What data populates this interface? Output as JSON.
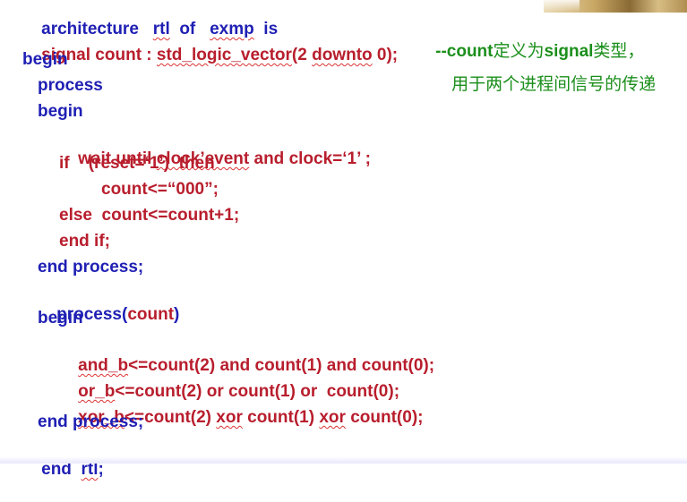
{
  "code": {
    "l1": {
      "a": "architecture",
      "b": "rtl",
      "c": "of",
      "d": "exmp",
      "e": "is"
    },
    "l2": {
      "a": "signal count : ",
      "b": "std_logic_vector",
      "c": "(2 ",
      "d": "downto",
      "e": " 0);"
    },
    "l3": "begin",
    "l4": "process",
    "l5": "begin",
    "l6": {
      "a": "wait until ",
      "b": "clock’event",
      "c": " and clock=‘1’ ;"
    },
    "l7": "if    (reset=‘1’)  then",
    "l8": "count<=“000”;",
    "l9": "else  count<=count+1;",
    "l10": "end if;",
    "l11": "end process;",
    "l12": {
      "a": "process(",
      "b": "count",
      "c": ")"
    },
    "l13": "begin",
    "l14": {
      "a": "and_b",
      "b": "<=count(2) and count(1) and count(0);"
    },
    "l15": {
      "a": "or_b",
      "b": "<=count(2) or count(1) or  count(0);"
    },
    "l16": {
      "a": "xor_b",
      "b": "<=count(2) ",
      "c": "xor",
      "d": " count(1) ",
      "e": "xor",
      "f": " count(0);"
    },
    "l17": "end process;",
    "l18": {
      "a": "end  ",
      "b": "rtl",
      "c": ";"
    }
  },
  "comment": {
    "p1": "--count",
    "p2": "定义为",
    "p3": "signal",
    "p4": "类型，",
    "line2": "用于两个进程间信号的传递"
  },
  "colors": {
    "keyword": "#1f1fb4",
    "code": "#b81e2d",
    "comment": "#1b8f1b"
  }
}
